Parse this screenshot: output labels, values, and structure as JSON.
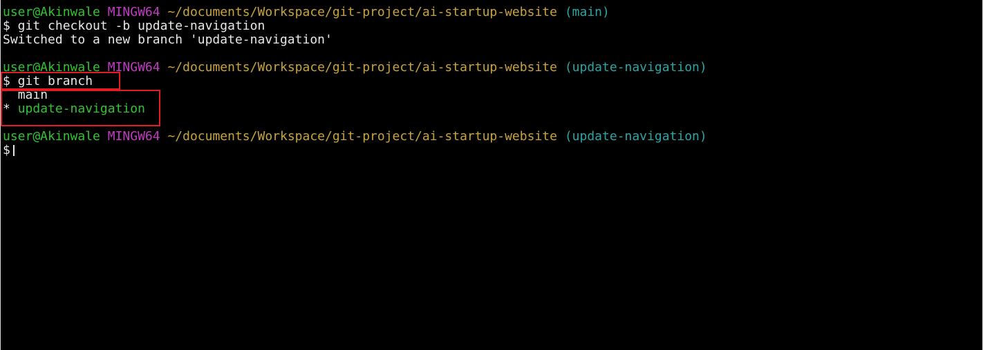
{
  "prompts": [
    {
      "user": "user@Akinwale",
      "host": "MINGW64",
      "path": "~/documents/Workspace/git-project/ai-startup-website",
      "branch": "(main)"
    },
    {
      "user": "user@Akinwale",
      "host": "MINGW64",
      "path": "~/documents/Workspace/git-project/ai-startup-website",
      "branch": "(update-navigation)"
    },
    {
      "user": "user@Akinwale",
      "host": "MINGW64",
      "path": "~/documents/Workspace/git-project/ai-startup-website",
      "branch": "(update-navigation)"
    }
  ],
  "commands": [
    "$ git checkout -b update-navigation",
    "$ git branch",
    "$"
  ],
  "outputs": {
    "checkout_result": "Switched to a new branch 'update-navigation'",
    "branch_list": [
      {
        "marker": " ",
        "name": "main",
        "current": false
      },
      {
        "marker": "*",
        "name": "update-navigation",
        "current": true
      }
    ]
  },
  "colors": {
    "background": "#000000",
    "user": "#31c431",
    "host": "#c23ac2",
    "path": "#c9a43a",
    "branch": "#2aa6a6",
    "text": "#e8e8e8",
    "highlight": "#e31b23"
  }
}
